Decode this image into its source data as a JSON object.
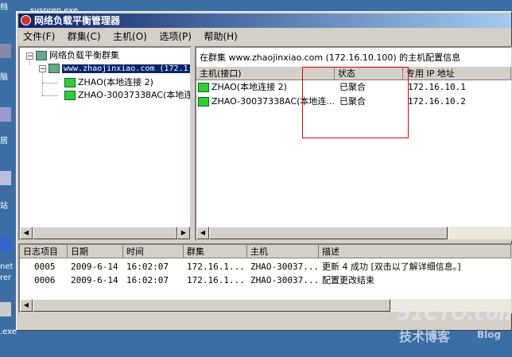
{
  "desktop": {
    "top_label": "sysprep.exe",
    "side_labels": [
      "档",
      "脑",
      "居",
      "站",
      "net",
      "rer",
      ".exe"
    ]
  },
  "window": {
    "title": "网络负载平衡管理器"
  },
  "menu": [
    "文件(F)",
    "群集(C)",
    "主机(O)",
    "选项(P)",
    "帮助(H)"
  ],
  "tree": {
    "root": "网络负载平衡群集",
    "cluster": "www.zhaojinxiao.com (172.1",
    "hosts": [
      "ZHAO(本地连接 2)",
      "ZHAO-30037338AC(本地连扌"
    ]
  },
  "host_panel": {
    "caption": "在群集 www.zhaojinxiao.com (172.16.10.100) 的主机配置信息",
    "columns": [
      "主机(接口)",
      "状态",
      "专用 IP 地址"
    ],
    "rows": [
      {
        "host": "ZHAO(本地连接 2)",
        "status": "已聚合",
        "ip": "172.16.10.1"
      },
      {
        "host": "ZHAO-30037338AC(本地连...",
        "status": "已聚合",
        "ip": "172.16.10.2"
      }
    ]
  },
  "log": {
    "columns": [
      "日志项目",
      "日期",
      "时间",
      "群集",
      "主机",
      "描述"
    ],
    "rows": [
      {
        "id": "0005",
        "date": "2009-6-14",
        "time": "16:02:07",
        "cluster": "172.16.1...",
        "host": "ZHAO-30037...",
        "desc": "更新 4 成功 [双击以了解详细信息。]"
      },
      {
        "id": "0006",
        "date": "2009-6-14",
        "time": "16:02:07",
        "cluster": "172.16.1...",
        "host": "ZHAO-30037...",
        "desc": "配置更改结束"
      }
    ]
  },
  "watermark": {
    "line1": "51CTO.com",
    "line2": "技术博客",
    "line3": "Blog"
  },
  "colors": {
    "desktop": "#3a6ea5",
    "titlebar_start": "#0a246a",
    "selection": "#0a246a",
    "annotation_box": "#ee0000"
  }
}
